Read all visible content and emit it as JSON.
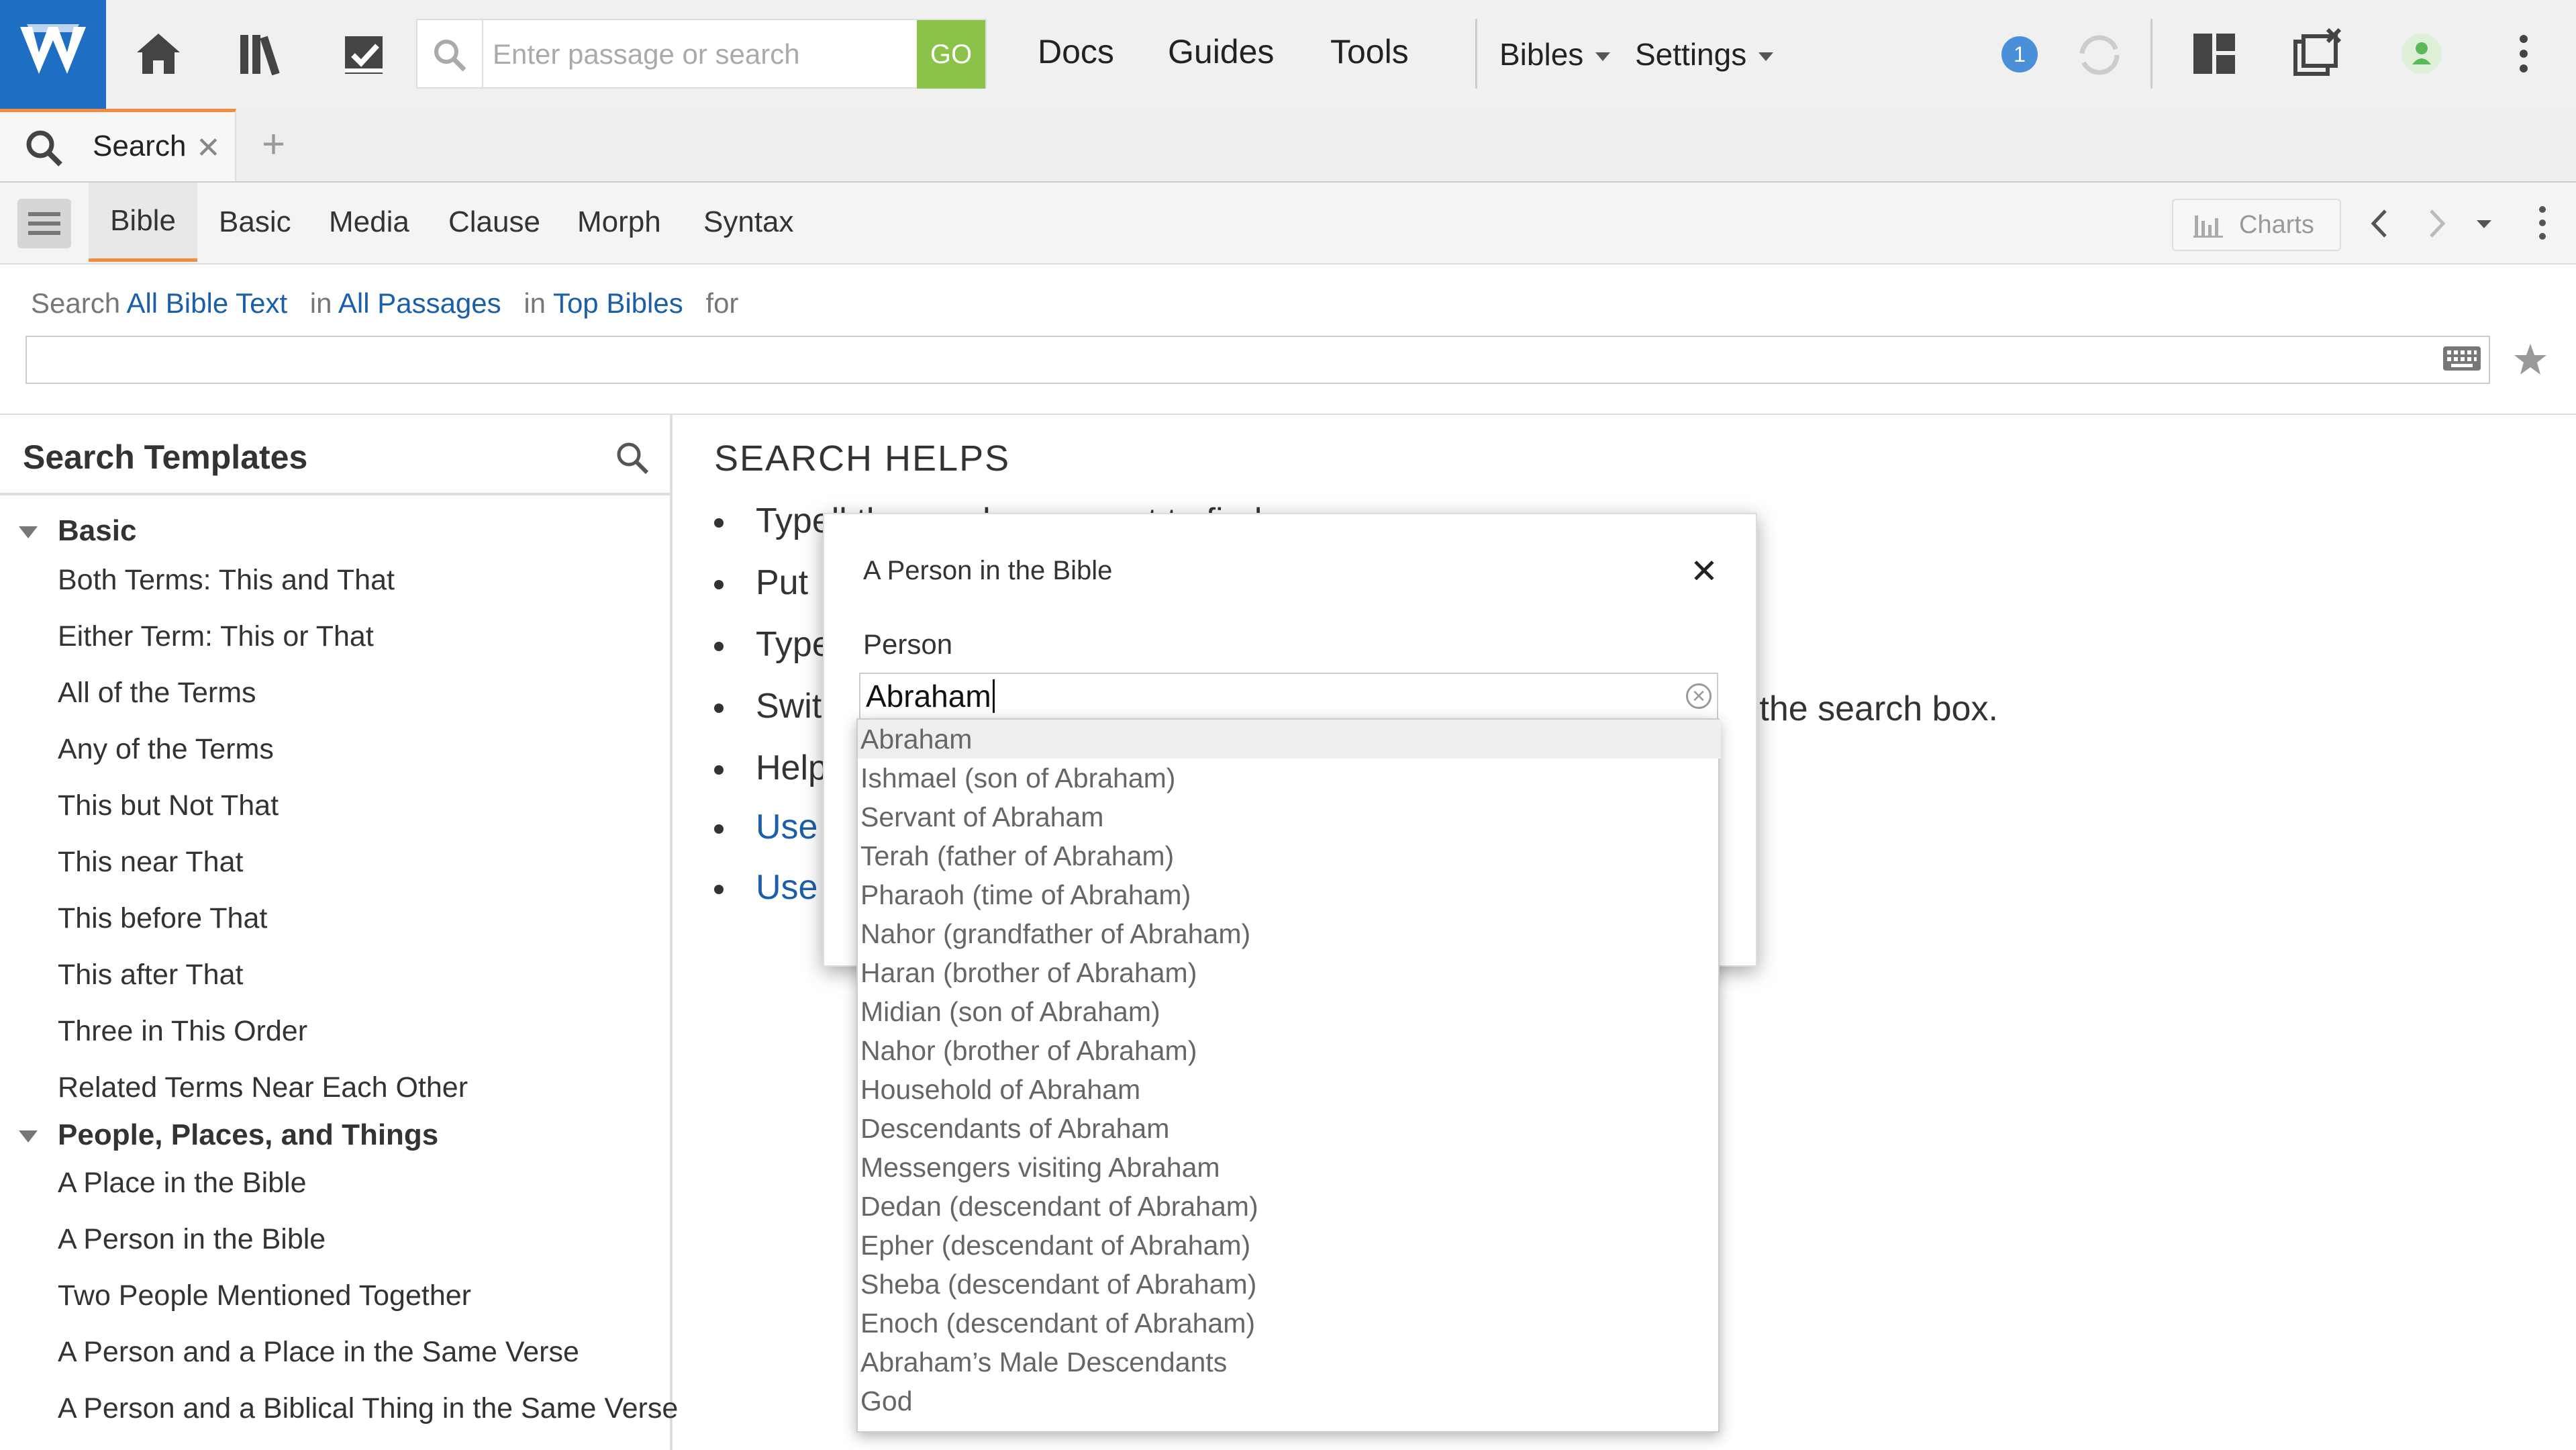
{
  "toolbar": {
    "search_placeholder": "Enter passage or search",
    "go_label": "GO",
    "nav": [
      "Docs",
      "Guides",
      "Tools"
    ],
    "bibles_label": "Bibles",
    "settings_label": "Settings",
    "notification_count": "1",
    "colors": {
      "logo_bg": "#1e6fc4",
      "go_bg": "#8bc34a",
      "accent": "#f58a3b",
      "link": "#1a5fa8"
    }
  },
  "tab": {
    "label": "Search"
  },
  "subtabs": {
    "items": [
      "Bible",
      "Basic",
      "Media",
      "Clause",
      "Morph",
      "Syntax"
    ],
    "active": "Bible",
    "charts_label": "Charts"
  },
  "scope": {
    "search_word": "Search",
    "what": "All Bible Text",
    "in1": "in",
    "where": "All Passages",
    "in2": "in",
    "which": "Top Bibles",
    "for_word": "for"
  },
  "left_panel": {
    "title": "Search Templates",
    "groups": [
      {
        "name": "Basic",
        "items": [
          "Both Terms: This and That",
          "Either Term: This or That",
          "All of the Terms",
          "Any of the Terms",
          "This but Not That",
          "This near That",
          "This before That",
          "This after That",
          "Three in This Order",
          "Related Terms Near Each Other"
        ]
      },
      {
        "name": "People, Places, and Things",
        "items": [
          "A Place in the Bible",
          "A Person in the Bible",
          "Two People Mentioned Together",
          "A Person and a Place in the Same Verse",
          "A Person and a Biblical Thing in the Same Verse"
        ]
      }
    ]
  },
  "helps": {
    "title": "SEARCH HELPS",
    "bullets": [
      "Type",
      "Put",
      "Type",
      "Swit",
      "Help",
      "Use",
      "Use"
    ],
    "partial_top": "ll the words you want to find.",
    "partial_tail": "n the search box."
  },
  "dialog": {
    "title": "A Person in the Bible",
    "close": "✕",
    "field_label": "Person",
    "field_value": "Abraham",
    "suggestions": [
      "Abraham",
      "Ishmael (son of Abraham)",
      "Servant of Abraham",
      "Terah (father of Abraham)",
      "Pharaoh (time of Abraham)",
      "Nahor (grandfather of Abraham)",
      "Haran (brother of Abraham)",
      "Midian (son of Abraham)",
      "Nahor (brother of Abraham)",
      "Household of Abraham",
      "Descendants of Abraham",
      "Messengers visiting Abraham",
      "Dedan (descendant of Abraham)",
      "Epher (descendant of Abraham)",
      "Sheba (descendant of Abraham)",
      "Enoch (descendant of Abraham)",
      "Abraham’s Male Descendants",
      "God"
    ]
  }
}
